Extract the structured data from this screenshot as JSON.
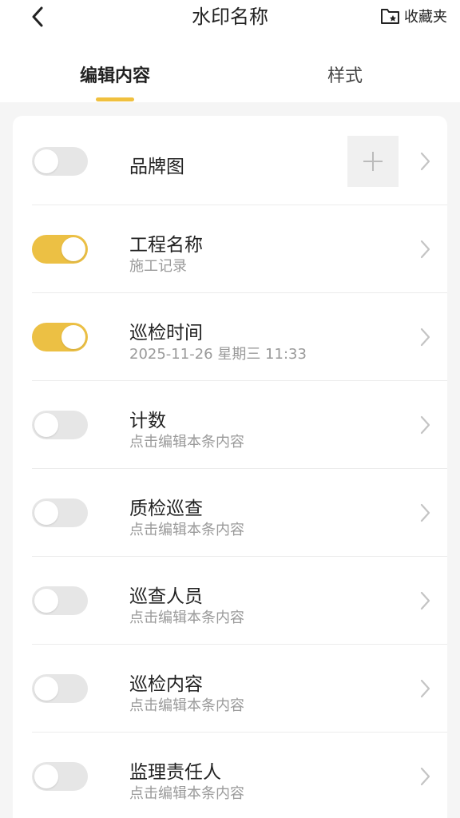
{
  "header": {
    "title": "水印名称",
    "favorites_label": "收藏夹"
  },
  "tabs": [
    {
      "label": "编辑内容",
      "active": true
    },
    {
      "label": "样式",
      "active": false
    }
  ],
  "colors": {
    "accent": "#f0c03e",
    "toggle_on": "#ecc044",
    "toggle_off": "#e6e6e6",
    "subtext": "#9a9a9a"
  },
  "rows": [
    {
      "title": "品牌图",
      "subtitle": "",
      "enabled": false,
      "has_add_image": true
    },
    {
      "title": "工程名称",
      "subtitle": "施工记录",
      "enabled": true
    },
    {
      "title": "巡检时间",
      "subtitle": "2025-11-26 星期三 11:33",
      "enabled": true
    },
    {
      "title": "计数",
      "subtitle": "点击编辑本条内容",
      "enabled": false
    },
    {
      "title": "质检巡查",
      "subtitle": "点击编辑本条内容",
      "enabled": false
    },
    {
      "title": "巡查人员",
      "subtitle": "点击编辑本条内容",
      "enabled": false
    },
    {
      "title": "巡检内容",
      "subtitle": "点击编辑本条内容",
      "enabled": false
    },
    {
      "title": "监理责任人",
      "subtitle": "点击编辑本条内容",
      "enabled": false
    }
  ]
}
